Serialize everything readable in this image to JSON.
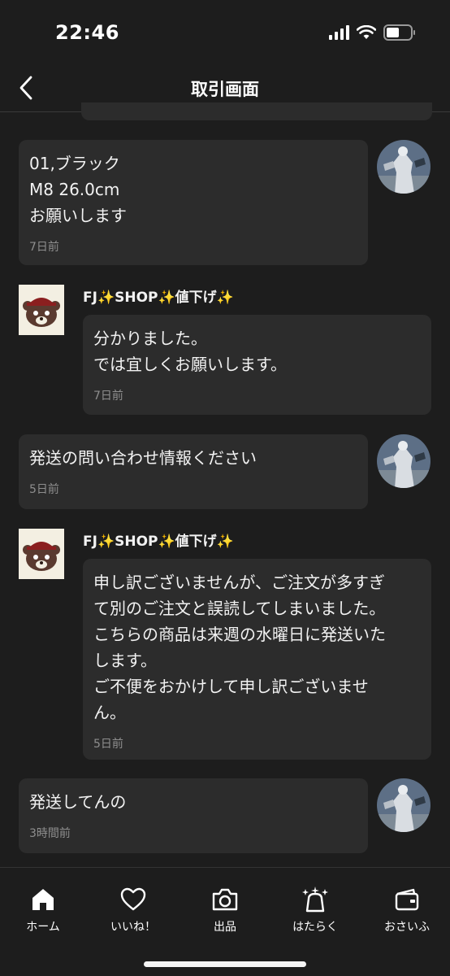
{
  "status_bar": {
    "time": "22:46"
  },
  "header": {
    "title": "取引画面"
  },
  "messages": [
    {
      "text": "01,ブラック\nM8 26.0cm\nお願いします",
      "time": "7日前"
    },
    {
      "sender": "FJ✨SHOP✨値下げ✨",
      "text": "分かりました。\nでは宜しくお願いします。",
      "time": "7日前"
    },
    {
      "text": "発送の問い合わせ情報ください",
      "time": "5日前"
    },
    {
      "sender": "FJ✨SHOP✨値下げ✨",
      "text": "申し訳ございませんが、ご注文が多すぎ\nて別のご注文と誤読してしまいました。\nこちらの商品は来週の水曜日に発送いた\nします。\nご不便をおかけして申し訳ございませ\nん。",
      "time": "5日前"
    },
    {
      "text": "発送してんの",
      "time": "3時間前"
    }
  ],
  "tab_bar": {
    "items": [
      {
        "label": "ホーム",
        "icon": "home-icon"
      },
      {
        "label": "いいね！",
        "icon": "heart-icon"
      },
      {
        "label": "出品",
        "icon": "camera-icon"
      },
      {
        "label": "はたらく",
        "icon": "sparkle-bag-icon"
      },
      {
        "label": "おさいふ",
        "icon": "wallet-icon"
      }
    ]
  }
}
